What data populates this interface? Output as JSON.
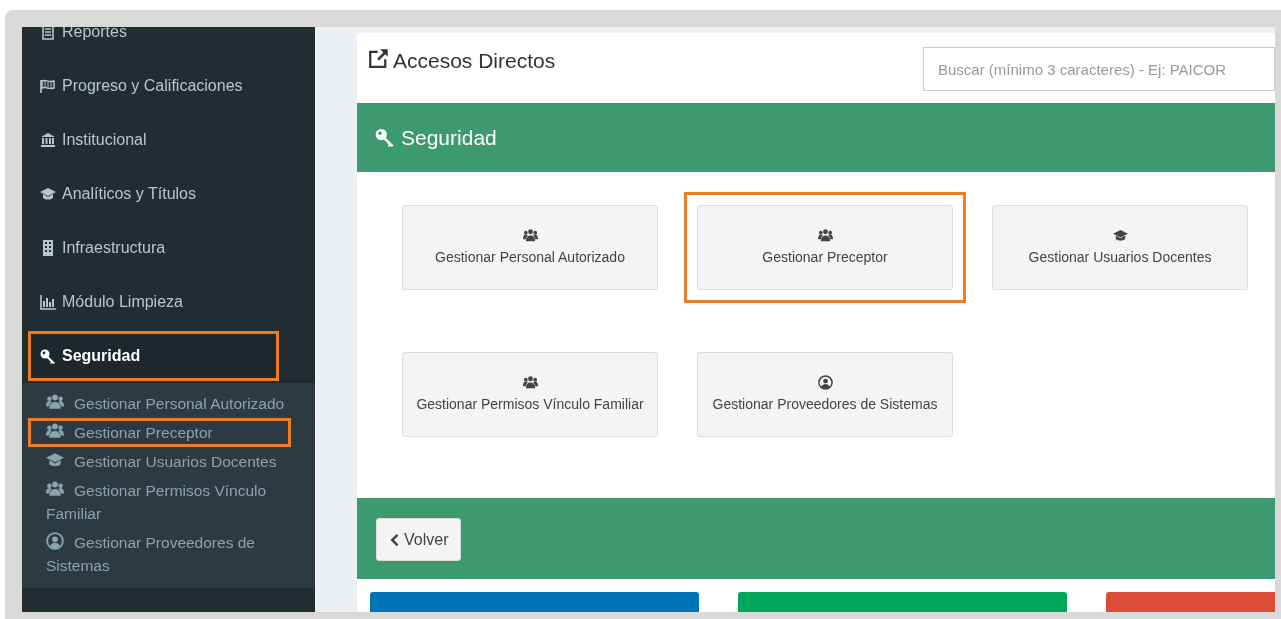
{
  "sidebar": {
    "items": [
      {
        "label": "Reportes",
        "kind": "document",
        "selected": false,
        "highlighted": false
      },
      {
        "label": "Progreso y Calificaciones",
        "kind": "flag",
        "selected": false,
        "highlighted": false
      },
      {
        "label": "Institucional",
        "kind": "bank",
        "selected": false,
        "highlighted": false
      },
      {
        "label": "Analíticos y Títulos",
        "kind": "cap",
        "selected": false,
        "highlighted": false
      },
      {
        "label": "Infraestructura",
        "kind": "building",
        "selected": false,
        "highlighted": false
      },
      {
        "label": "Módulo Limpieza",
        "kind": "chart",
        "selected": false,
        "highlighted": false
      },
      {
        "label": "Seguridad",
        "kind": "key",
        "selected": true,
        "highlighted": true
      }
    ],
    "submenu": [
      {
        "label": "Gestionar Personal Autorizado",
        "kind": "users",
        "highlighted": false
      },
      {
        "label": "Gestionar Preceptor",
        "kind": "users",
        "highlighted": true
      },
      {
        "label": "Gestionar Usuarios Docentes",
        "kind": "cap",
        "highlighted": false
      },
      {
        "label": "Gestionar Permisos Vínculo Familiar",
        "kind": "users",
        "highlighted": false
      },
      {
        "label": "Gestionar Proveedores de Sistemas",
        "kind": "person",
        "highlighted": false
      }
    ]
  },
  "shortcuts": {
    "title": "Accesos Directos",
    "search": {
      "placeholder": "Buscar (mínimo 3 caracteres) - Ej: PAICOR"
    }
  },
  "section": {
    "title": "Seguridad",
    "tiles": [
      {
        "label": "Gestionar Personal Autorizado",
        "kind": "users",
        "highlighted": false
      },
      {
        "label": "Gestionar Preceptor",
        "kind": "users",
        "highlighted": true
      },
      {
        "label": "Gestionar Usuarios Docentes",
        "kind": "cap",
        "highlighted": false
      },
      {
        "label": "Gestionar Permisos Vínculo Familiar",
        "kind": "users",
        "highlighted": false
      },
      {
        "label": "Gestionar Proveedores de Sistemas",
        "kind": "person",
        "highlighted": false
      }
    ]
  },
  "back_button": {
    "label": "Volver"
  },
  "bottom_boxes": [
    {
      "color": "#0073b7"
    },
    {
      "color": "#00a65a"
    },
    {
      "color": "#dd4b39"
    }
  ]
}
